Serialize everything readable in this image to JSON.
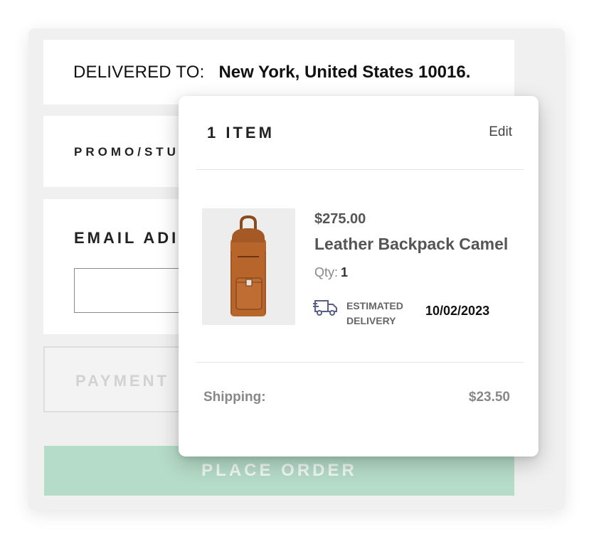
{
  "delivery": {
    "label": "DELIVERED TO:",
    "address": "New York, United States 10016."
  },
  "promo": {
    "label": "PROMO/STU"
  },
  "email": {
    "label": "EMAIL ADI",
    "value": ""
  },
  "payment": {
    "label": "PAYMENT"
  },
  "place_order": {
    "label": "PLACE ORDER"
  },
  "cart_popup": {
    "item_count": "1 ITEM",
    "edit_label": "Edit",
    "item": {
      "image_icon": "backpack-product-image",
      "price": "$275.00",
      "name": "Leather Backpack Camel",
      "qty_label": "Qty:",
      "qty_value": "1",
      "delivery_icon": "truck-icon",
      "estimated_delivery_label": "ESTIMATED DELIVERY",
      "estimated_delivery_date": "10/02/2023"
    },
    "shipping_label": "Shipping:",
    "shipping_value": "$23.50"
  },
  "colors": {
    "place_order_bg": "#b5dcc8",
    "panel_bg": "#f0f0f0",
    "backpack_leather": "#b8652c"
  }
}
